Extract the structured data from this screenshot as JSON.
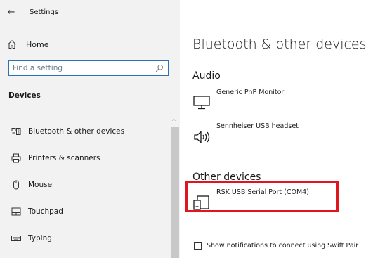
{
  "window": {
    "title": "Settings"
  },
  "sidebar": {
    "home_label": "Home",
    "search_placeholder": "Find a setting",
    "section_label": "Devices",
    "items": [
      {
        "label": "Bluetooth & other devices",
        "icon": "bluetooth-devices-icon"
      },
      {
        "label": "Printers & scanners",
        "icon": "printer-icon"
      },
      {
        "label": "Mouse",
        "icon": "mouse-icon"
      },
      {
        "label": "Touchpad",
        "icon": "touchpad-icon"
      },
      {
        "label": "Typing",
        "icon": "keyboard-icon"
      }
    ]
  },
  "main": {
    "title": "Bluetooth & other devices",
    "audio": {
      "label": "Audio",
      "devices": [
        {
          "name": "Generic PnP Monitor",
          "icon": "monitor-icon"
        },
        {
          "name": "Sennheiser USB headset",
          "icon": "speaker-icon"
        }
      ]
    },
    "other": {
      "label": "Other devices",
      "devices": [
        {
          "name": "RSK USB Serial Port (COM4)",
          "icon": "serial-port-device-icon"
        }
      ]
    },
    "swift_pair": {
      "label": "Show notifications to connect using Swift Pair",
      "checked": false
    }
  },
  "colors": {
    "highlight": "#e0161f",
    "search_border": "#2b72b8",
    "sidebar_bg": "#f2f2f2"
  }
}
